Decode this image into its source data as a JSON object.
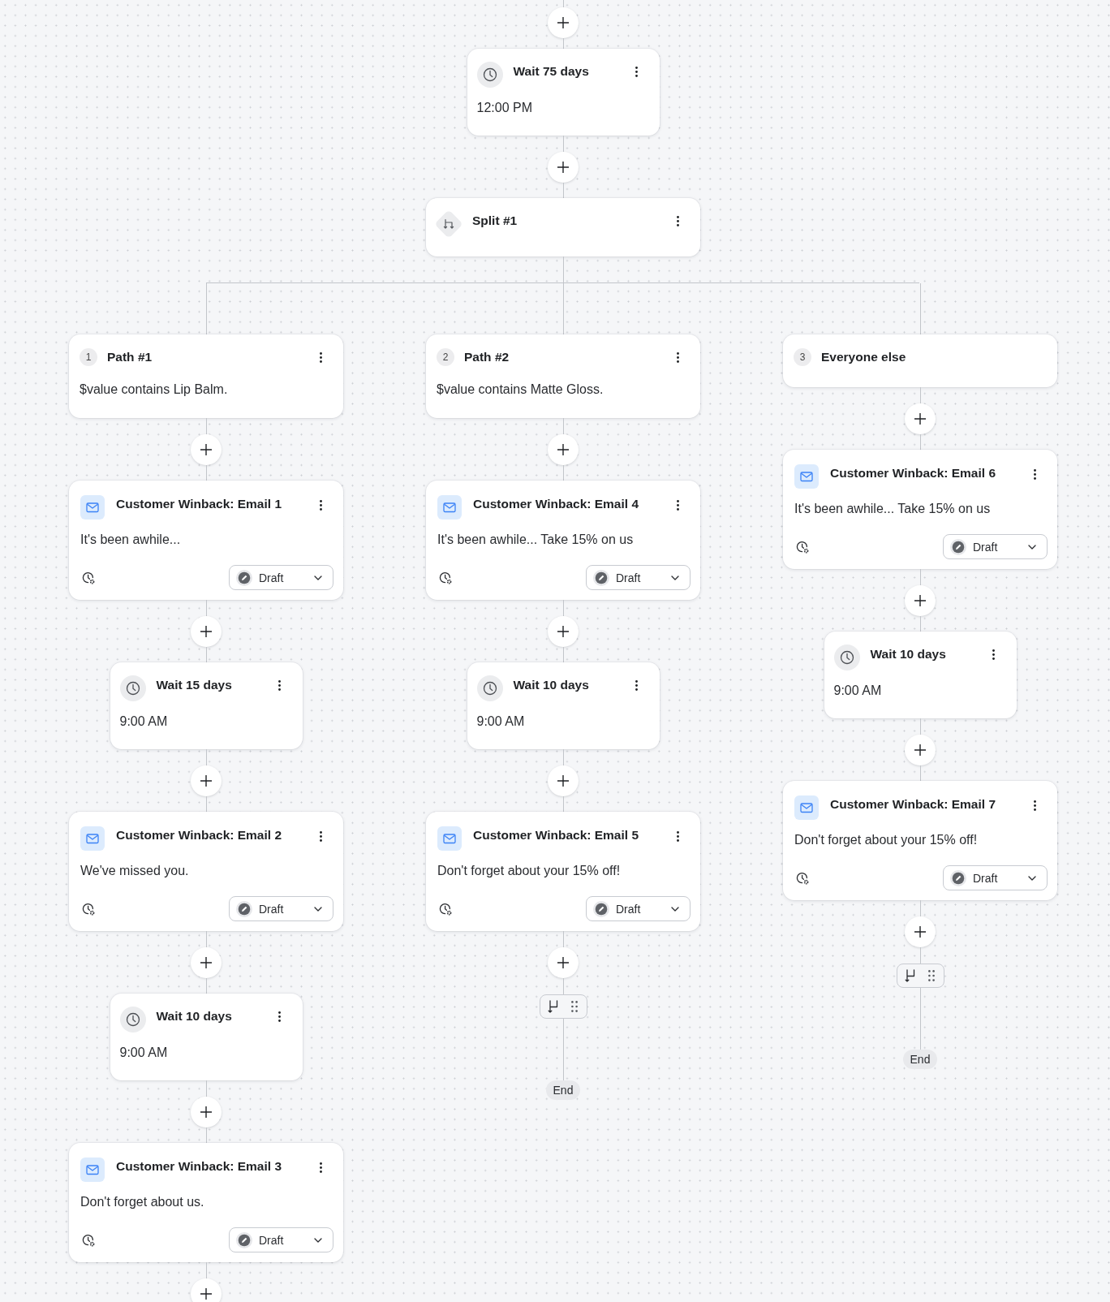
{
  "top_steps": [
    {
      "kind": "wait",
      "title": "Wait 75 days",
      "time": "12:00 PM"
    },
    {
      "kind": "split",
      "title": "Split #1"
    }
  ],
  "branches": [
    {
      "number": "1",
      "title": "Path #1",
      "condition": "$value contains Lip Balm.",
      "menu": true,
      "steps": [
        {
          "kind": "email",
          "title": "Customer Winback: Email 1",
          "subject": "It's been awhile...",
          "status": "Draft"
        },
        {
          "kind": "wait",
          "title": "Wait 15 days",
          "time": "9:00 AM"
        },
        {
          "kind": "email",
          "title": "Customer Winback: Email 2",
          "subject": "We've missed you.",
          "status": "Draft"
        },
        {
          "kind": "wait",
          "title": "Wait 10 days",
          "time": "9:00 AM"
        },
        {
          "kind": "email",
          "title": "Customer Winback: Email 3",
          "subject": "Don't forget about us.",
          "status": "Draft"
        }
      ]
    },
    {
      "number": "2",
      "title": "Path #2",
      "condition": "$value contains Matte Gloss.",
      "menu": true,
      "steps": [
        {
          "kind": "email",
          "title": "Customer Winback: Email 4",
          "subject": "It's been awhile... Take 15% on us",
          "status": "Draft"
        },
        {
          "kind": "wait",
          "title": "Wait 10 days",
          "time": "9:00 AM"
        },
        {
          "kind": "email",
          "title": "Customer Winback: Email 5",
          "subject": "Don't forget about your 15% off!",
          "status": "Draft"
        }
      ],
      "end": "End"
    },
    {
      "number": "3",
      "title": "Everyone else",
      "menu": false,
      "steps": [
        {
          "kind": "email",
          "title": "Customer Winback: Email 6",
          "subject": "It's been awhile... Take 15% on us",
          "status": "Draft"
        },
        {
          "kind": "wait",
          "title": "Wait 10 days",
          "time": "9:00 AM"
        },
        {
          "kind": "email",
          "title": "Customer Winback: Email 7",
          "subject": "Don't forget about your 15% off!",
          "status": "Draft"
        }
      ],
      "end": "End"
    }
  ]
}
